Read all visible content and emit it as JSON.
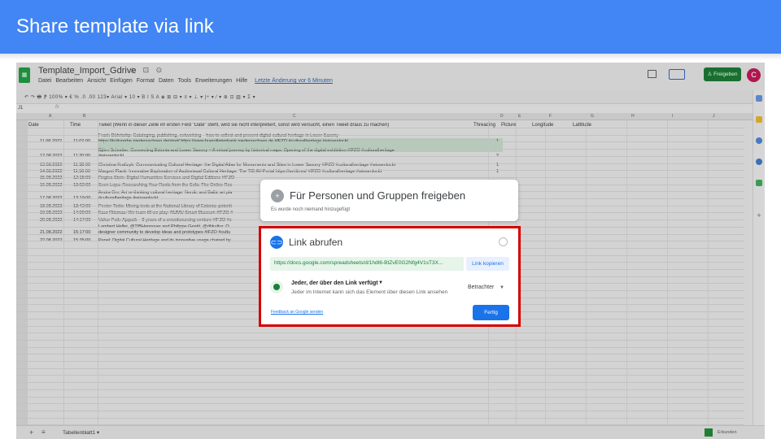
{
  "slide": {
    "title": "Share template via link",
    "banner_color": "#4285f4"
  },
  "sheets": {
    "doc_title": "Template_Import_Gdrive",
    "doc_icons": "☆ ⊡ ⊙",
    "menu": [
      "Datei",
      "Bearbeiten",
      "Ansicht",
      "Einfügen",
      "Format",
      "Daten",
      "Tools",
      "Erweiterungen",
      "Hilfe"
    ],
    "last_edit": "Letzte Änderung vor 6 Minuten",
    "share_label": "Freigeben",
    "avatar_letter": "C",
    "toolbar_text": "↶ ↷ 🖶 ⁋   100% ▾   € % .0 .00 123▾   Arial ▾   10 ▾   B I S A   ◈ ⊞ ⊟ ▾   ≡ ▾ ⊥ ▾ |÷ ▾ ⁄ ▾   ⊕ ⊡ ▥ ▾ Σ ▾",
    "cell_ref": "J1",
    "fx": "fx",
    "columns": [
      "A",
      "B",
      "C",
      "D",
      "E",
      "F",
      "G",
      "H",
      "I",
      "J"
    ],
    "headers": {
      "date": "Date",
      "time": "Time",
      "tweet": "Tweet (Wenn in dieser Zelle im ersten Feld \"Date\" steht, wird sie nicht interpretiert, sonst wird versucht, einen Tweet draus zu machen)",
      "threading": "Threading",
      "picture": "Picture",
      "longitude": "Longitude",
      "lattitude": "Lattitude"
    },
    "rows": [
      {
        "date": "11.08.2022",
        "time": "11:02:00",
        "tweet": "Frank Dührkohp: Cataloging, publishing, networking – how to collect and present digital cultural heritage in Lower Saxony",
        "tweet2": "https://kulturerbe.niedersachsen.de/start/  https://www.buerolletenbank.niedersachsen.de #IFZO #culturalheritage #wissenlockt",
        "thr": "1"
      },
      {
        "date": "12.08.2022",
        "time": "11:20:00",
        "tweet": "Björn Schreiter: Connecting Estonia and Lower Saxony – A virtual journey by historical maps. Opening of the digital exhibition #IFZO #culturalheritage",
        "tweet2": "#wissenlockt",
        "thr": "2"
      },
      {
        "date": "13.08.2022",
        "time": "11:38:00",
        "tweet": "Christina Kraftzyk: Communicating Cultural Heritage: the Digital Atlas for Monuments and Sites in Lower Saxony #IFZO #culturalheritage #wissenlockt",
        "tweet2": "",
        "thr": "1"
      },
      {
        "date": "14.08.2022",
        "time": "11:56:00",
        "tweet": "Margret Plank: Innovative Exploration of Audiovisual Cultural Heritage: The TIB AV-Portal https://av.tib.eu/ #IFZO #culturalheritage #wissenlockt",
        "tweet2": "",
        "thr": "1"
      },
      {
        "date": "15.08.2022",
        "time": "12:15:00",
        "tweet": "Regina Stein: Digital Humanities Services and Digital Editions #IFZO",
        "tweet2": "",
        "thr": ""
      },
      {
        "date": "16.08.2022",
        "time": "13:02:00",
        "tweet": "Sven Lepa: Researching Your Roots from the Sofa: The Online Res",
        "tweet2": "",
        "thr": ""
      },
      {
        "date": "17.08.2022",
        "time": "13:19:00",
        "tweet": "Andra Orn: Art re-thinking cultural heritage. Nordic and Baltic art pla",
        "tweet2": "#culturalheritage #wissenlockt",
        "thr": ""
      },
      {
        "date": "18.08.2022",
        "time": "13:42:00",
        "tweet": "Peeter Tinits: Mining texts at the National Library of Estonia: potenti",
        "tweet2": "",
        "thr": ""
      },
      {
        "date": "19.08.2022",
        "time": "14:00:00",
        "tweet": "Kaur Ritsmaa: We learn till we play: NUMU Smart Museum #IFZO #",
        "tweet2": "",
        "thr": ""
      },
      {
        "date": "20.08.2022",
        "time": "14:17:00",
        "tweet": "Vahur Puik: Ajapaik – 9 years of a crowdsourcing venture #IFZO #c",
        "tweet2": "",
        "thr": ""
      },
      {
        "date": "21.08.2022",
        "time": "15:17:00",
        "tweet": "Lambert Heller, @TIBHannover  and Philippe Genêt, @dbkultur: O",
        "tweet2": "designer community to develop ideas and  prototypes #IFZO #cultu",
        "thr": ""
      },
      {
        "date": "22.08.2022",
        "time": "15:35:00",
        "tweet": "Panel: Digital Cultural Heritage and its innovative usage chaired by",
        "tweet2": "",
        "thr": ""
      }
    ],
    "tab_name": "Tabellenblatt1 ▾",
    "explore_label": "Erkunden"
  },
  "people_dialog": {
    "title": "Für Personen und Gruppen freigeben",
    "subtitle": "Es wurde noch niemand hinzugefügt"
  },
  "link_dialog": {
    "title": "Link abrufen",
    "url": "https://docs.google.com/spreadsheets/d/1hdt6-BtZvE0G2Nfg4V1sT3X...",
    "copy_label": "Link kopieren",
    "access_label": "Jeder, der über den Link verfügt",
    "access_desc": "Jeder im Internet kann sich das Element über diesen Link ansehen",
    "role": "Betrachter",
    "feedback": "Feedback an Google senden",
    "done": "Fertig",
    "highlight_color": "#d40000"
  }
}
